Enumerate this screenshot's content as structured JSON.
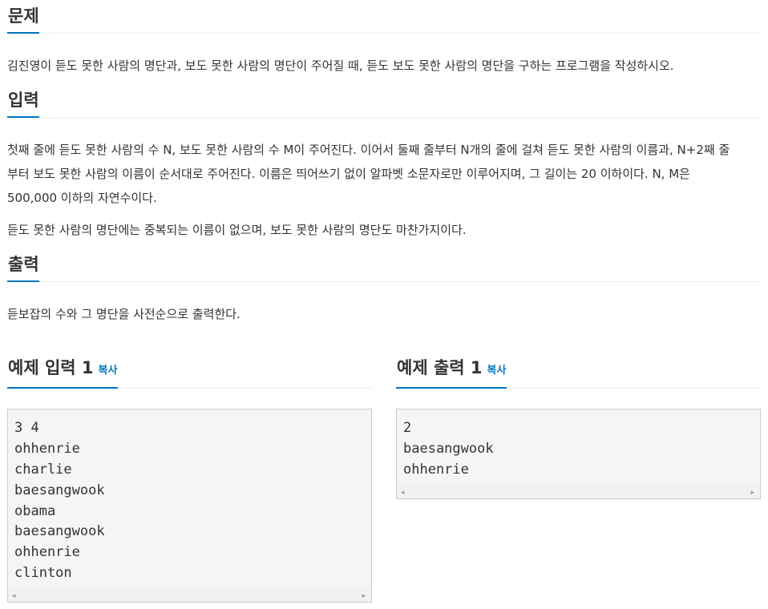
{
  "sections": {
    "problem": {
      "title": "문제",
      "body": "김진영이 듣도 못한 사람의 명단과, 보도 못한 사람의 명단이 주어질 때, 듣도 보도 못한 사람의 명단을 구하는 프로그램을 작성하시오."
    },
    "input": {
      "title": "입력",
      "lines": [
        "첫째 줄에 듣도 못한 사람의 수 N, 보도 못한 사람의 수 M이 주어진다. 이어서 둘째 줄부터 N개의 줄에 걸쳐 듣도 못한 사람의 이름과, N+2째 줄",
        "부터 보도 못한 사람의 이름이 순서대로 주어진다. 이름은 띄어쓰기 없이 알파벳 소문자로만 이루어지며, 그 길이는 20 이하이다. N, M은",
        "500,000 이하의 자연수이다."
      ],
      "extra": "듣도 못한 사람의 명단에는 중복되는 이름이 없으며, 보도 못한 사람의 명단도 마찬가지이다."
    },
    "output": {
      "title": "출력",
      "body": "듣보잡의 수와 그 명단을 사전순으로 출력한다."
    }
  },
  "samples": {
    "input": {
      "title": "예제 입력 1",
      "copy_label": "복사",
      "lines": [
        "3 4",
        "ohhenrie",
        "charlie",
        "baesangwook",
        "obama",
        "baesangwook",
        "ohhenrie",
        "clinton"
      ]
    },
    "output": {
      "title": "예제 출력 1",
      "copy_label": "복사",
      "lines": [
        "2",
        "baesangwook",
        "ohhenrie"
      ]
    }
  },
  "icons": {
    "scroll_left": "◂",
    "scroll_right": "▸"
  },
  "colors": {
    "accent": "#0076c0",
    "pre_background": "#f5f5f5",
    "text": "#333333"
  }
}
